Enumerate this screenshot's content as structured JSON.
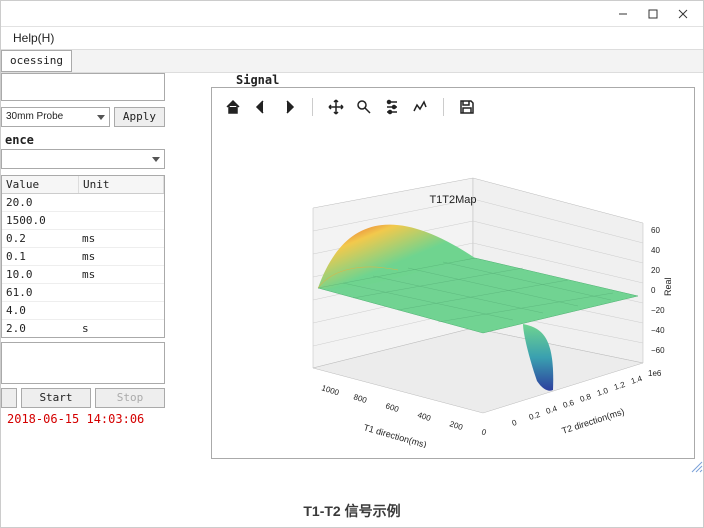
{
  "titlebar": {},
  "menu": {
    "help": "Help(H)"
  },
  "tabs": {
    "processing": "ocessing"
  },
  "probe": {
    "label": "30mm Probe",
    "apply": "Apply"
  },
  "group_sequence": "ence",
  "tableHeaders": {
    "value": "Value",
    "unit": "Unit"
  },
  "params": [
    {
      "value": "20.0",
      "unit": ""
    },
    {
      "value": "1500.0",
      "unit": ""
    },
    {
      "value": "0.2",
      "unit": "ms"
    },
    {
      "value": "0.1",
      "unit": "ms"
    },
    {
      "value": "10.0",
      "unit": "ms"
    },
    {
      "value": "61.0",
      "unit": ""
    },
    {
      "value": "4.0",
      "unit": ""
    },
    {
      "value": "2.0",
      "unit": "s"
    }
  ],
  "buttons": {
    "start": "Start",
    "stop": "Stop"
  },
  "timestamp": "2018-06-15 14:03:06",
  "signal_label": "Signal",
  "caption": "T1-T2 信号示例",
  "chart_data": {
    "type": "surface3d",
    "title": "T1T2Map",
    "x_axis": {
      "label": "T1 direction(ms)",
      "ticks": [
        0,
        200,
        400,
        600,
        800,
        1000
      ]
    },
    "y_axis": {
      "label": "T2 direction(ms)",
      "scale": "1e6",
      "ticks": [
        0,
        0.2,
        0.4,
        0.6,
        0.8,
        1.0,
        1.2,
        1.4
      ]
    },
    "z_axis": {
      "label": "Real",
      "ticks": [
        -60,
        -40,
        -20,
        0,
        20,
        40,
        60
      ]
    },
    "note": "surface highest along small T1 & small T2 (red, ~60), flattens to ~0 across plane (green), dips sharply to ~-60 (blue) near T1≈0, T2≈max"
  }
}
